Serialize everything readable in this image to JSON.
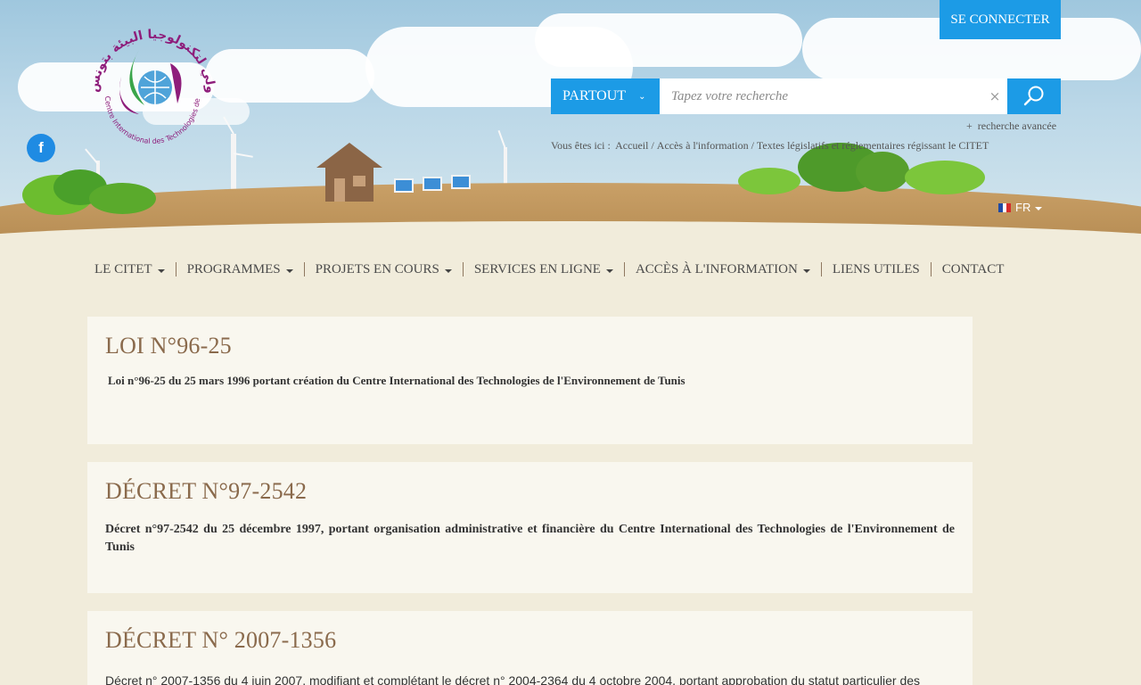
{
  "header": {
    "logo_text_arabic": "المركز الدولي لتكنولوجيا البيئة بتونس",
    "logo_text_french": "Centre International des Technologies de l'Environnement de Tunis",
    "facebook_icon": "f",
    "login_label": "SE CONNECTER",
    "search": {
      "scope_label": "PARTOUT",
      "placeholder": "Tapez votre recherche",
      "clear_symbol": "×",
      "advanced_label": "recherche avancée",
      "advanced_prefix": "+"
    },
    "breadcrumb": {
      "prefix": "Vous êtes ici :",
      "items": [
        "Accueil",
        "Accès à l'information",
        "Textes législatifs et réglementaires régissant le CITET"
      ]
    },
    "language": "FR"
  },
  "nav": {
    "items": [
      {
        "label": "LE CITET",
        "dropdown": true
      },
      {
        "label": "PROGRAMMES",
        "dropdown": true
      },
      {
        "label": "PROJETS EN COURS",
        "dropdown": true
      },
      {
        "label": "SERVICES EN LIGNE",
        "dropdown": true
      },
      {
        "label": "ACCÈS À L'INFORMATION",
        "dropdown": true
      },
      {
        "label": "LIENS UTILES",
        "dropdown": false
      },
      {
        "label": "CONTACT",
        "dropdown": false
      }
    ]
  },
  "cards": [
    {
      "title": "LOI N°96-25",
      "text": "Loi n°96-25 du 25 mars 1996 portant création du Centre International des Technologies de l'Environnement de Tunis"
    },
    {
      "title": "DÉCRET N°97-2542",
      "text": "Décret n°97-2542 du 25 décembre 1997, portant organisation administrative et financière du Centre International des Technologies de l'Environnement de Tunis"
    },
    {
      "title": "DÉCRET N° 2007-1356",
      "text": "Décret n° 2007-1356 du 4 juin 2007, modifiant et complétant le décret n° 2004-2364 du 4 octobre 2004, portant approbation du statut particulier des"
    }
  ],
  "colors": {
    "accent": "#1c9be6",
    "title": "#8a6a4c",
    "background": "#f1ecdb",
    "card": "#f9f7ef"
  }
}
